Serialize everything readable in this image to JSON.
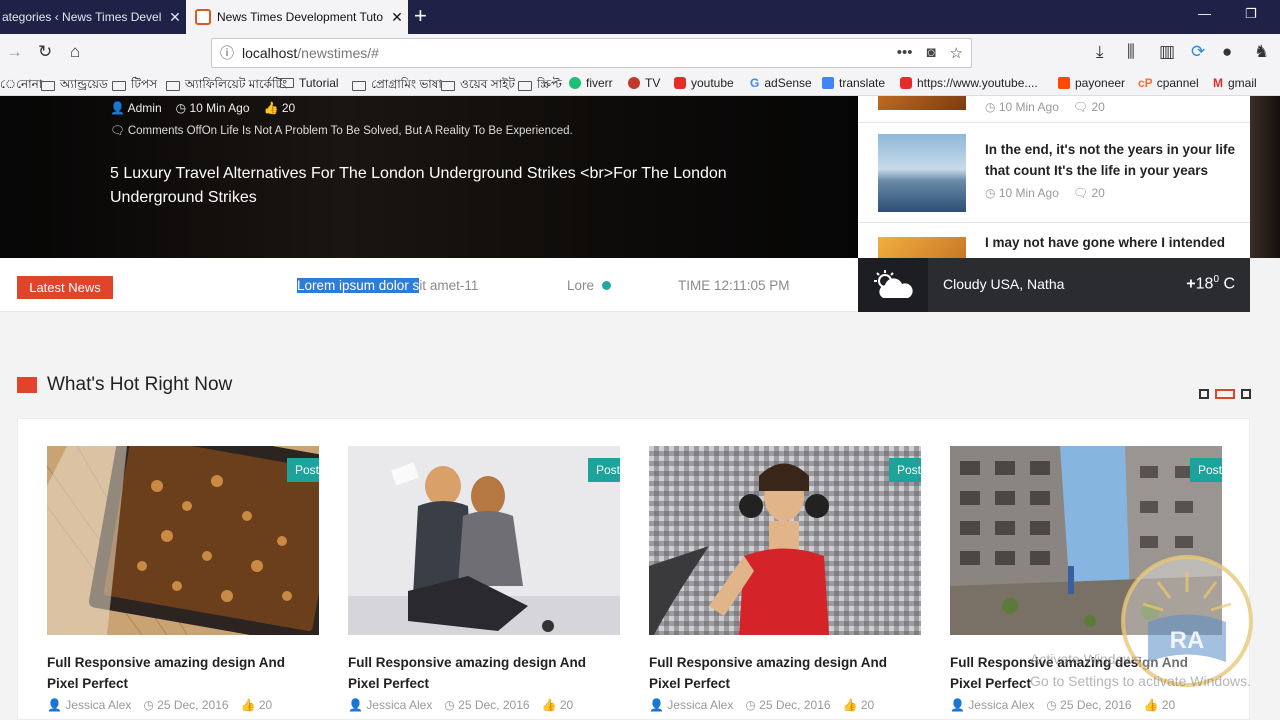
{
  "browser": {
    "tabs": [
      {
        "title": "ategories ‹ News Times Devel",
        "active": false
      },
      {
        "title": "News Times Development Tuto",
        "active": true
      }
    ],
    "url_host": "localhost",
    "url_path": "/newstimes/#",
    "bookmarks": [
      "েনোনা",
      "অ্যান্ড্রয়েড",
      "টিপস",
      "অ্যাফিলিয়েট মার্কেটিং",
      "Tutorial",
      "প্রোগ্রামিং ভাষা",
      "ওয়েব সাইট",
      "স্ক্রিপ্ট",
      "fiverr",
      "TV",
      "youtube",
      "adSense",
      "translate",
      "https://www.youtube....",
      "payoneer",
      "cpannel",
      "gmail"
    ]
  },
  "hero": {
    "author": "Admin",
    "time": "10 Min Ago",
    "likes": "20",
    "comments": "Comments OffOn Life Is Not A Problem To Be Solved, But A Reality To Be Experienced.",
    "title": "5 Luxury Travel Alternatives For The London Underground Strikes <br>For The London Underground Strikes"
  },
  "sidebar": [
    {
      "title": "",
      "time": "10 Min Ago",
      "comments": "20"
    },
    {
      "title": "In the end, it's not the years in your life that count It's the life in your years",
      "time": "10 Min Ago",
      "comments": "20"
    },
    {
      "title": "I may not have gone where I intended",
      "time": "",
      "comments": ""
    }
  ],
  "ticker": {
    "label": "Latest News",
    "selected": "Lorem ipsum dolor s",
    "rest": "it amet-11",
    "second": "Lore",
    "time": "TIME 12:11:05 PM"
  },
  "weather": {
    "location": "Cloudy USA, Natha",
    "temp_prefix": "+",
    "temp_value": "18",
    "temp_sup": "0",
    "temp_unit": " C"
  },
  "section": {
    "title": "What's Hot Right Now"
  },
  "cards": [
    {
      "badge": "Post",
      "title": "Full Responsive amazing design And Pixel Perfect",
      "author": "Jessica Alex",
      "date": "25 Dec, 2016",
      "likes": "20"
    },
    {
      "badge": "Post",
      "title": "Full Responsive amazing design And Pixel Perfect",
      "author": "Jessica Alex",
      "date": "25 Dec, 2016",
      "likes": "20"
    },
    {
      "badge": "Post",
      "title": "Full Responsive amazing design And Pixel Perfect",
      "author": "Jessica Alex",
      "date": "25 Dec, 2016",
      "likes": "20"
    },
    {
      "badge": "Post",
      "title": "Full Responsive amazing design And Pixel Perfect",
      "author": "Jessica Alex",
      "date": "25 Dec, 2016",
      "likes": "20"
    }
  ],
  "overlay": {
    "watermark_line1": "Activate Windows",
    "watermark_line2": "Go to Settings to activate Windows.",
    "logo_text": "RA"
  },
  "colors": {
    "accent_red": "#e0442b",
    "accent_teal": "#1ba39c",
    "tabbar_bg": "#1f2147"
  }
}
